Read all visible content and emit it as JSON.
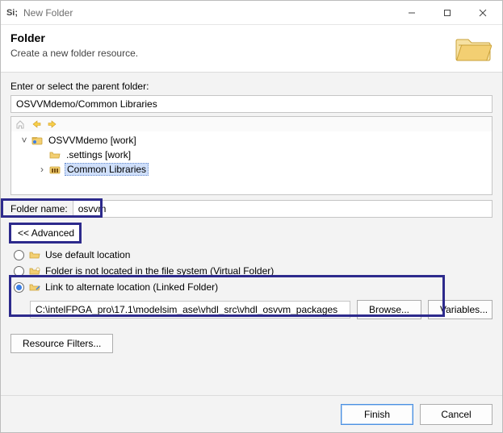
{
  "titlebar": {
    "app_icon_text": "Si;",
    "title": "New Folder"
  },
  "header": {
    "heading": "Folder",
    "subheading": "Create a new folder resource."
  },
  "parent": {
    "label": "Enter or select the parent folder:",
    "value": "OSVVMdemo/Common Libraries"
  },
  "tree": {
    "items": [
      {
        "label": "OSVVMdemo [work]",
        "expanded": true,
        "depth": 1
      },
      {
        "label": ".settings [work]",
        "expanded": false,
        "depth": 2
      },
      {
        "label": "Common Libraries",
        "expanded": false,
        "depth": 2,
        "selected": true,
        "expander": ">"
      }
    ]
  },
  "folder_name": {
    "label": "Folder name:",
    "value": "osvvm"
  },
  "advanced": {
    "toggle_label": "<< Advanced"
  },
  "location_options": {
    "default_label": "Use default location",
    "virtual_label": "Folder is not located in the file system (Virtual Folder)",
    "linked_label": "Link to alternate location (Linked Folder)",
    "selected_index": 2,
    "linked_path": "C:\\intelFPGA_pro\\17.1\\modelsim_ase\\vhdl_src\\vhdl_osvvm_packages",
    "browse_label": "Browse...",
    "variables_label": "Variables..."
  },
  "resource_filters_label": "Resource Filters...",
  "footer": {
    "finish": "Finish",
    "cancel": "Cancel"
  },
  "icons": {
    "home": "home-icon",
    "back": "back-arrow-icon",
    "forward": "forward-arrow-icon"
  }
}
